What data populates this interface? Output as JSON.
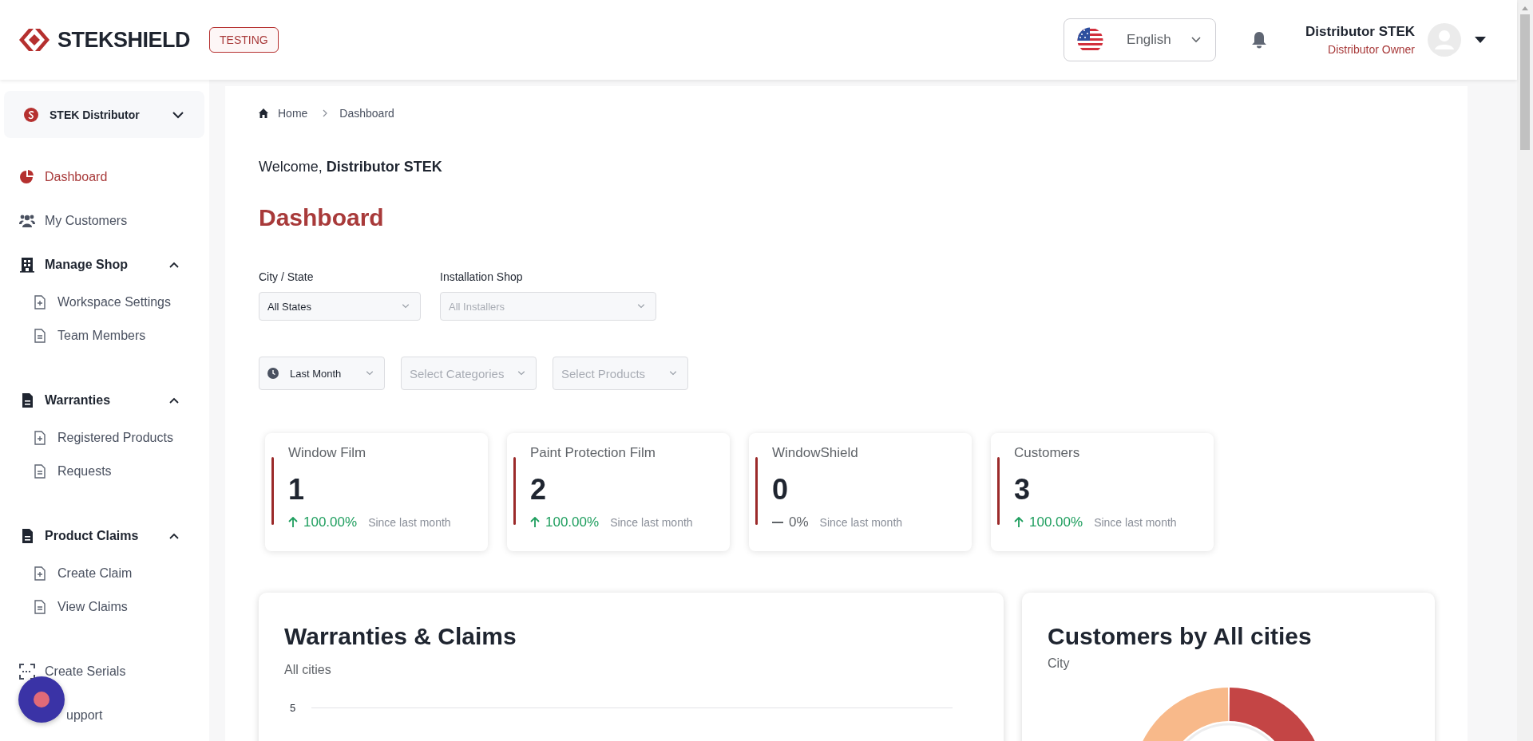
{
  "header": {
    "logo": "STEKSHIELD",
    "environment_badge": "TESTING",
    "language": {
      "label": "English"
    },
    "user": {
      "name": "Distributor STEK",
      "role": "Distributor Owner"
    }
  },
  "sidebar": {
    "organization": "STEK Distributor",
    "items": [
      {
        "kind": "link",
        "label": "Dashboard",
        "selected": true
      },
      {
        "kind": "link",
        "label": "My Customers",
        "selected": false
      },
      {
        "kind": "group",
        "label": "Manage Shop",
        "expanded": true,
        "children": [
          {
            "label": "Workspace Settings",
            "selected": false
          },
          {
            "label": "Team Members",
            "selected": false
          }
        ]
      },
      {
        "kind": "group",
        "label": "Warranties",
        "expanded": true,
        "children": [
          {
            "label": "Registered Products",
            "selected": false
          },
          {
            "label": "Requests",
            "selected": false
          }
        ]
      },
      {
        "kind": "group",
        "label": "Product Claims",
        "expanded": true,
        "children": [
          {
            "label": "Create Claim",
            "selected": false
          },
          {
            "label": "View Claims",
            "selected": false
          }
        ]
      },
      {
        "kind": "link",
        "label": "Create Serials",
        "selected": false
      },
      {
        "kind": "link",
        "label": "upport",
        "selected": false
      }
    ]
  },
  "breadcrumb": [
    "Home",
    "Dashboard"
  ],
  "welcome": "Welcome, **Distributor STEK**",
  "title": "Dashboard",
  "filters": [
    {
      "label": "City / State",
      "value": "All States"
    },
    {
      "label": "Installation Shop",
      "placeholder": "All Installers"
    }
  ],
  "period_filters": [
    {
      "kind": "time",
      "value": "Last Month"
    },
    {
      "kind": "select",
      "placeholder": "Select Categories"
    },
    {
      "kind": "select",
      "placeholder": "Select Products"
    }
  ],
  "stats": [
    {
      "label": "Window Film",
      "value": "1",
      "kind": "up",
      "change": "100.00%",
      "note": "Since last month"
    },
    {
      "label": "Paint Protection Film",
      "value": "2",
      "kind": "up",
      "change": "100.00%",
      "note": "Since last month"
    },
    {
      "label": "WindowShield",
      "value": "0",
      "kind": "flat",
      "change": "0%",
      "note": "Since last month"
    },
    {
      "label": "Customers",
      "value": "3",
      "kind": "up",
      "change": "100.00%",
      "note": "Since last month"
    }
  ],
  "panels": [
    {
      "kind": "bar",
      "title": "Warranties & Claims",
      "subtitle": "All cities",
      "axis_tick": "5"
    },
    {
      "kind": "donut",
      "title": "Customers by All cities",
      "subtitle": "City"
    }
  ]
}
